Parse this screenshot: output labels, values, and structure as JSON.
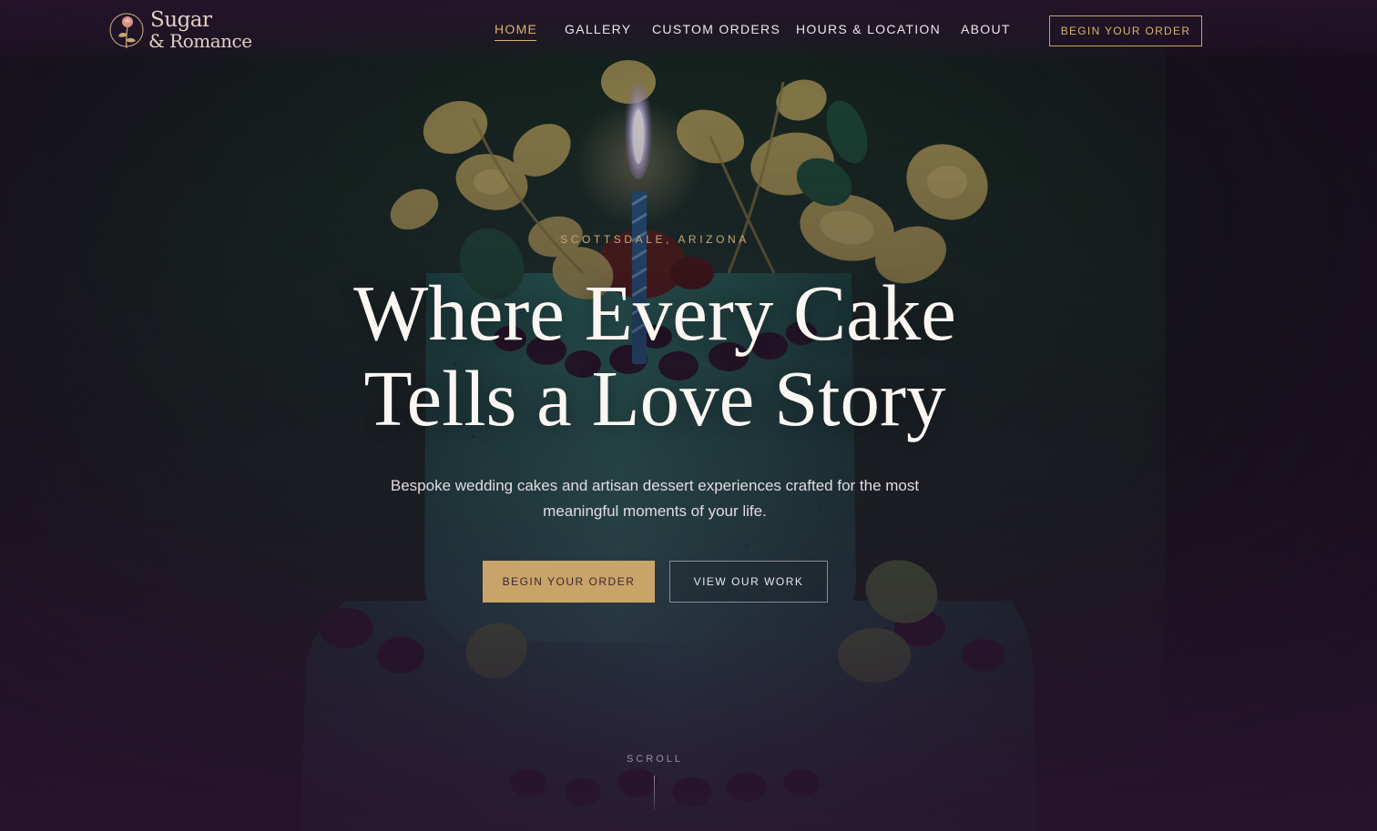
{
  "brand": {
    "name_line1": "Sugar",
    "name_line2": "& Romance"
  },
  "nav": {
    "items": [
      {
        "label": "HOME",
        "active": true
      },
      {
        "label": "GALLERY",
        "active": false
      },
      {
        "label": "CUSTOM ORDERS",
        "active": false
      },
      {
        "label": "HOURS & LOCATION",
        "active": false
      },
      {
        "label": "ABOUT",
        "active": false
      }
    ],
    "cta_label": "BEGIN YOUR ORDER"
  },
  "hero": {
    "eyebrow": "SCOTTSDALE, ARIZONA",
    "headline_line1": "Where Every Cake",
    "headline_line2": "Tells a Love Story",
    "subtitle": "Bespoke wedding cakes and artisan dessert experiences crafted for the most meaningful moments of your life.",
    "primary_button": "BEGIN YOUR ORDER",
    "secondary_button": "VIEW OUR WORK",
    "scroll_label": "SCROLL"
  },
  "colors": {
    "accent_gold": "#c9a468",
    "overlay_purple": "#2a1530",
    "cake_teal": "#2c6b62"
  },
  "icons": {
    "logo_emblem": "rose-emblem-icon"
  }
}
